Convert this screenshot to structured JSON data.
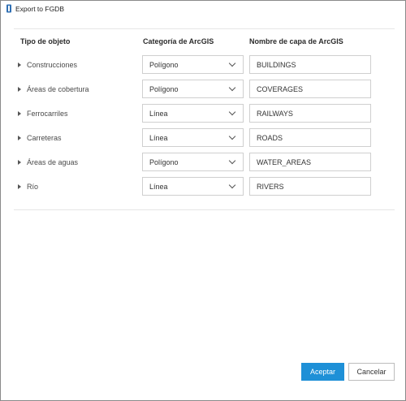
{
  "window": {
    "title": "Export to FGDB"
  },
  "table": {
    "headers": {
      "object_type": "Tipo de objeto",
      "arcgis_category": "Categoría de ArcGIS",
      "layer_name": "Nombre de capa de ArcGIS"
    },
    "rows": [
      {
        "object_type": "Construcciones",
        "category": "Polígono",
        "layer_name": "BUILDINGS"
      },
      {
        "object_type": "Áreas de cobertura",
        "category": "Polígono",
        "layer_name": "COVERAGES"
      },
      {
        "object_type": "Ferrocarriles",
        "category": "Línea",
        "layer_name": "RAILWAYS"
      },
      {
        "object_type": "Carreteras",
        "category": "Línea",
        "layer_name": "ROADS"
      },
      {
        "object_type": "Áreas de aguas",
        "category": "Polígono",
        "layer_name": "WATER_AREAS"
      },
      {
        "object_type": "Río",
        "category": "Línea",
        "layer_name": "RIVERS"
      }
    ]
  },
  "buttons": {
    "accept": "Aceptar",
    "cancel": "Cancelar"
  },
  "colors": {
    "primary": "#1e90d7",
    "border": "#cfcfcf"
  },
  "icons": {
    "app": "app-icon",
    "expand": "triangle-right-icon",
    "dropdown": "chevron-down-icon"
  }
}
